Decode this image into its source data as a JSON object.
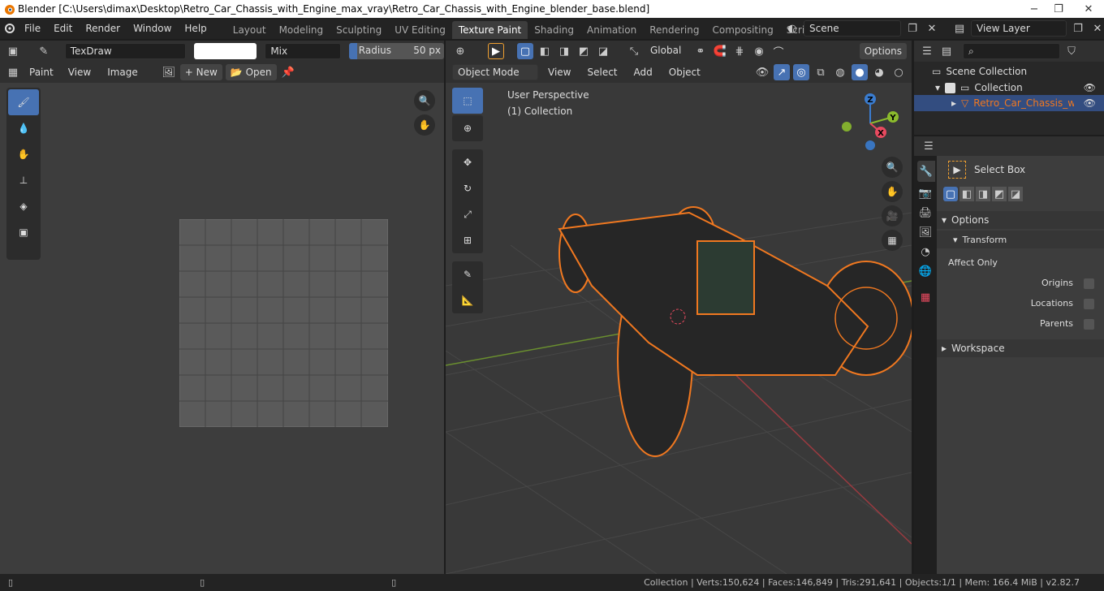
{
  "window": {
    "title": "Blender [C:\\Users\\dimax\\Desktop\\Retro_Car_Chassis_with_Engine_max_vray\\Retro_Car_Chassis_with_Engine_blender_base.blend]",
    "buttons": [
      "−",
      "❐",
      "✕"
    ]
  },
  "menu": [
    "File",
    "Edit",
    "Render",
    "Window",
    "Help"
  ],
  "workspaces": [
    {
      "label": "Layout",
      "active": false
    },
    {
      "label": "Modeling",
      "active": false
    },
    {
      "label": "Sculpting",
      "active": false
    },
    {
      "label": "UV Editing",
      "active": false
    },
    {
      "label": "Texture Paint",
      "active": true
    },
    {
      "label": "Shading",
      "active": false
    },
    {
      "label": "Animation",
      "active": false
    },
    {
      "label": "Rendering",
      "active": false
    },
    {
      "label": "Compositing",
      "active": false
    },
    {
      "label": "Scripting",
      "active": false
    }
  ],
  "scene": {
    "label": "Scene",
    "view_layer": "View Layer"
  },
  "image_editor": {
    "brush_name": "TexDraw",
    "blend_mode": "Mix",
    "radius_label": "Radius",
    "radius_value": "50 px",
    "mode": "Paint",
    "view": "View",
    "image": "Image",
    "new": "New",
    "open": "Open"
  },
  "viewport": {
    "orientation": "Global",
    "options": "Options",
    "mode": "Object Mode",
    "view": "View",
    "select": "Select",
    "add": "Add",
    "object": "Object",
    "perspective": "User Perspective",
    "collection": "(1) Collection",
    "axes": {
      "x": "X",
      "y": "Y",
      "z": "Z"
    }
  },
  "outliner": {
    "scene_collection": "Scene Collection",
    "collection": "Collection",
    "object": "Retro_Car_Chassis_with_"
  },
  "properties": {
    "tool": "Select Box",
    "options": "Options",
    "transform": "Transform",
    "affect_only": "Affect Only",
    "origins": "Origins",
    "locations": "Locations",
    "parents": "Parents",
    "workspace": "Workspace"
  },
  "statusbar": "Collection | Verts:150,624 | Faces:146,849 | Tris:291,641 | Objects:1/1 | Mem: 166.4 MiB | v2.82.7",
  "colors": {
    "accent": "#4772b3",
    "selection": "#f07820",
    "x_axis": "#e84a5f",
    "y_axis": "#8bbb2d",
    "z_axis": "#3a7ccf"
  }
}
